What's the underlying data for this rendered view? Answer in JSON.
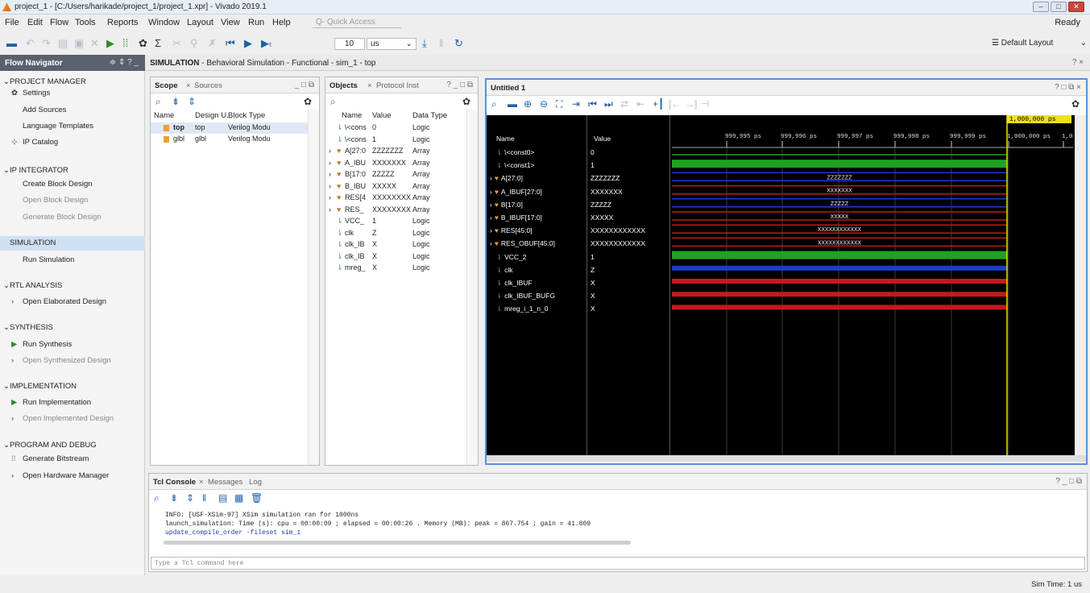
{
  "window": {
    "title": "project_1 - [C:/Users/harikade/project_1/project_1.xpr] - Vivado 2019.1",
    "controls": [
      "–",
      "□",
      "✕"
    ]
  },
  "menu": {
    "items": [
      "File",
      "Edit",
      "Flow",
      "Tools",
      "Reports",
      "Window",
      "Layout",
      "View",
      "Run",
      "Help"
    ],
    "quick_access": "Q- Quick Access",
    "status": "Ready"
  },
  "toolbar": {
    "time_value": "10",
    "time_unit": "us",
    "layout": "Default Layout"
  },
  "flow_navigator": {
    "title": "Flow Navigator",
    "header_controls": "≑ ⇕ ? _",
    "items": [
      {
        "label": "PROJECT MANAGER",
        "kind": "section"
      },
      {
        "label": "Settings",
        "kind": "item",
        "icon": "gear-icon"
      },
      {
        "label": "Add Sources",
        "kind": "item"
      },
      {
        "label": "Language Templates",
        "kind": "item"
      },
      {
        "label": "IP Catalog",
        "kind": "item",
        "icon": "ip-icon"
      },
      {
        "label": "IP INTEGRATOR",
        "kind": "section"
      },
      {
        "label": "Create Block Design",
        "kind": "item"
      },
      {
        "label": "Open Block Design",
        "kind": "dim"
      },
      {
        "label": "Generate Block Design",
        "kind": "dim"
      },
      {
        "label": "SIMULATION",
        "kind": "section-selected"
      },
      {
        "label": "Run Simulation",
        "kind": "item"
      },
      {
        "label": "RTL ANALYSIS",
        "kind": "section"
      },
      {
        "label": "Open Elaborated Design",
        "kind": "item",
        "icon": "chevron-right-icon"
      },
      {
        "label": "SYNTHESIS",
        "kind": "section"
      },
      {
        "label": "Run Synthesis",
        "kind": "item",
        "icon": "play-icon"
      },
      {
        "label": "Open Synthesized Design",
        "kind": "dim",
        "icon": "chevron-right-icon"
      },
      {
        "label": "IMPLEMENTATION",
        "kind": "section"
      },
      {
        "label": "Run Implementation",
        "kind": "item",
        "icon": "play-icon"
      },
      {
        "label": "Open Implemented Design",
        "kind": "dim",
        "icon": "chevron-right-icon"
      },
      {
        "label": "PROGRAM AND DEBUG",
        "kind": "section"
      },
      {
        "label": "Generate Bitstream",
        "kind": "item",
        "icon": "bitstream-icon"
      },
      {
        "label": "Open Hardware Manager",
        "kind": "item",
        "icon": "chevron-right-icon"
      }
    ]
  },
  "sim_header": {
    "bold": "SIMULATION",
    "rest": " - Behavioral Simulation - Functional - sim_1 - top",
    "help": "? ×"
  },
  "scope": {
    "tabs": [
      "Scope",
      "Sources"
    ],
    "controls": "_ □ ⧉",
    "columns": [
      "Name",
      "Design U...",
      "Block Type"
    ],
    "rows": [
      [
        "top",
        "top",
        "Verilog Modu"
      ],
      [
        "glbl",
        "glbl",
        "Verilog Modu"
      ]
    ]
  },
  "objects": {
    "tabs": [
      "Objects",
      "Protocol Inst"
    ],
    "controls": "? _ □ ⧉",
    "columns": [
      "Name",
      "Value",
      "Data Type"
    ],
    "rows": [
      [
        "",
        "\\<cons",
        "0",
        "Logic"
      ],
      [
        "",
        "\\<cons",
        "1",
        "Logic"
      ],
      [
        ">",
        "A[27:0",
        "ZZZZZZZ",
        "Array"
      ],
      [
        ">",
        "A_IBU",
        "XXXXXXX",
        "Array"
      ],
      [
        ">",
        "B[17:0",
        "ZZZZZ",
        "Array"
      ],
      [
        ">",
        "B_IBU",
        "XXXXX",
        "Array"
      ],
      [
        ">",
        "RES[4",
        "XXXXXXXXXX",
        "Array"
      ],
      [
        ">",
        "RES_",
        "XXXXXXXXXX",
        "Array"
      ],
      [
        "",
        "VCC_",
        "1",
        "Logic"
      ],
      [
        "",
        "clk",
        "Z",
        "Logic"
      ],
      [
        "",
        "clk_IB",
        "X",
        "Logic"
      ],
      [
        "",
        "clk_IB",
        "X",
        "Logic"
      ],
      [
        "",
        "mreg_",
        "X",
        "Logic"
      ]
    ]
  },
  "waveform": {
    "title": "Untitled 1",
    "controls": "? □ ⧉ ×",
    "cursor_label": "1,000,000 ps",
    "columns": [
      "Name",
      "Value"
    ],
    "ticks": [
      "999,995 ps",
      "999,996 ps",
      "999,997 ps",
      "999,998 ps",
      "999,999 ps",
      "1,000,000 ps",
      "1,0"
    ],
    "signals": [
      {
        "name": "\\<const0>",
        "value": "0",
        "kind": "low",
        "expand": "",
        "bus_text": ""
      },
      {
        "name": "\\<const1>",
        "value": "1",
        "kind": "high",
        "expand": "",
        "bus_text": ""
      },
      {
        "name": "A[27:0]",
        "value": "ZZZZZZZ",
        "kind": "busz",
        "expand": ">",
        "bus_text": "ZZZZZZZ"
      },
      {
        "name": "A_IBUF[27:0]",
        "value": "XXXXXXX",
        "kind": "busx",
        "expand": ">",
        "bus_text": "XXXXXXX"
      },
      {
        "name": "B[17:0]",
        "value": "ZZZZZ",
        "kind": "busz",
        "expand": ">",
        "bus_text": "ZZZZZ"
      },
      {
        "name": "B_IBUF[17:0]",
        "value": "XXXXX",
        "kind": "busx",
        "expand": ">",
        "bus_text": "XXXXX"
      },
      {
        "name": "RES[45:0]",
        "value": "XXXXXXXXXXXX",
        "kind": "busx",
        "expand": ">",
        "bus_text": "XXXXXXXXXXXX"
      },
      {
        "name": "RES_OBUF[45:0]",
        "value": "XXXXXXXXXXXX",
        "kind": "busx",
        "expand": ">",
        "bus_text": "XXXXXXXXXXXX"
      },
      {
        "name": "VCC_2",
        "value": "1",
        "kind": "high",
        "expand": "",
        "bus_text": ""
      },
      {
        "name": "clk",
        "value": "Z",
        "kind": "z",
        "expand": "",
        "bus_text": ""
      },
      {
        "name": "clk_IBUF",
        "value": "X",
        "kind": "x",
        "expand": "",
        "bus_text": ""
      },
      {
        "name": "clk_IBUF_BUFG",
        "value": "X",
        "kind": "x",
        "expand": "",
        "bus_text": ""
      },
      {
        "name": "mreg_i_1_n_0",
        "value": "X",
        "kind": "x",
        "expand": "",
        "bus_text": ""
      }
    ]
  },
  "tcl": {
    "tabs": [
      "Tcl Console",
      "Messages",
      "Log"
    ],
    "controls": "? _ □ ⧉",
    "lines": [
      "INFO: [USF-XSim-97] XSim simulation ran for 1000ns",
      "launch_simulation: Time (s): cpu = 00:00:09 ; elapsed = 00:00:26 . Memory (MB): peak = 867.754 ; gain = 41.809",
      "update_compile_order -fileset sim_1"
    ],
    "placeholder": "Type a Tcl command here"
  },
  "status": {
    "sim_time": "Sim Time: 1 us"
  },
  "colors": {
    "wave_green": "#1fa21f",
    "wave_red": "#c41a1a",
    "wave_blue": "#1a3ccc",
    "cursor": "#f0e020",
    "accent": "#5b8fd6"
  }
}
